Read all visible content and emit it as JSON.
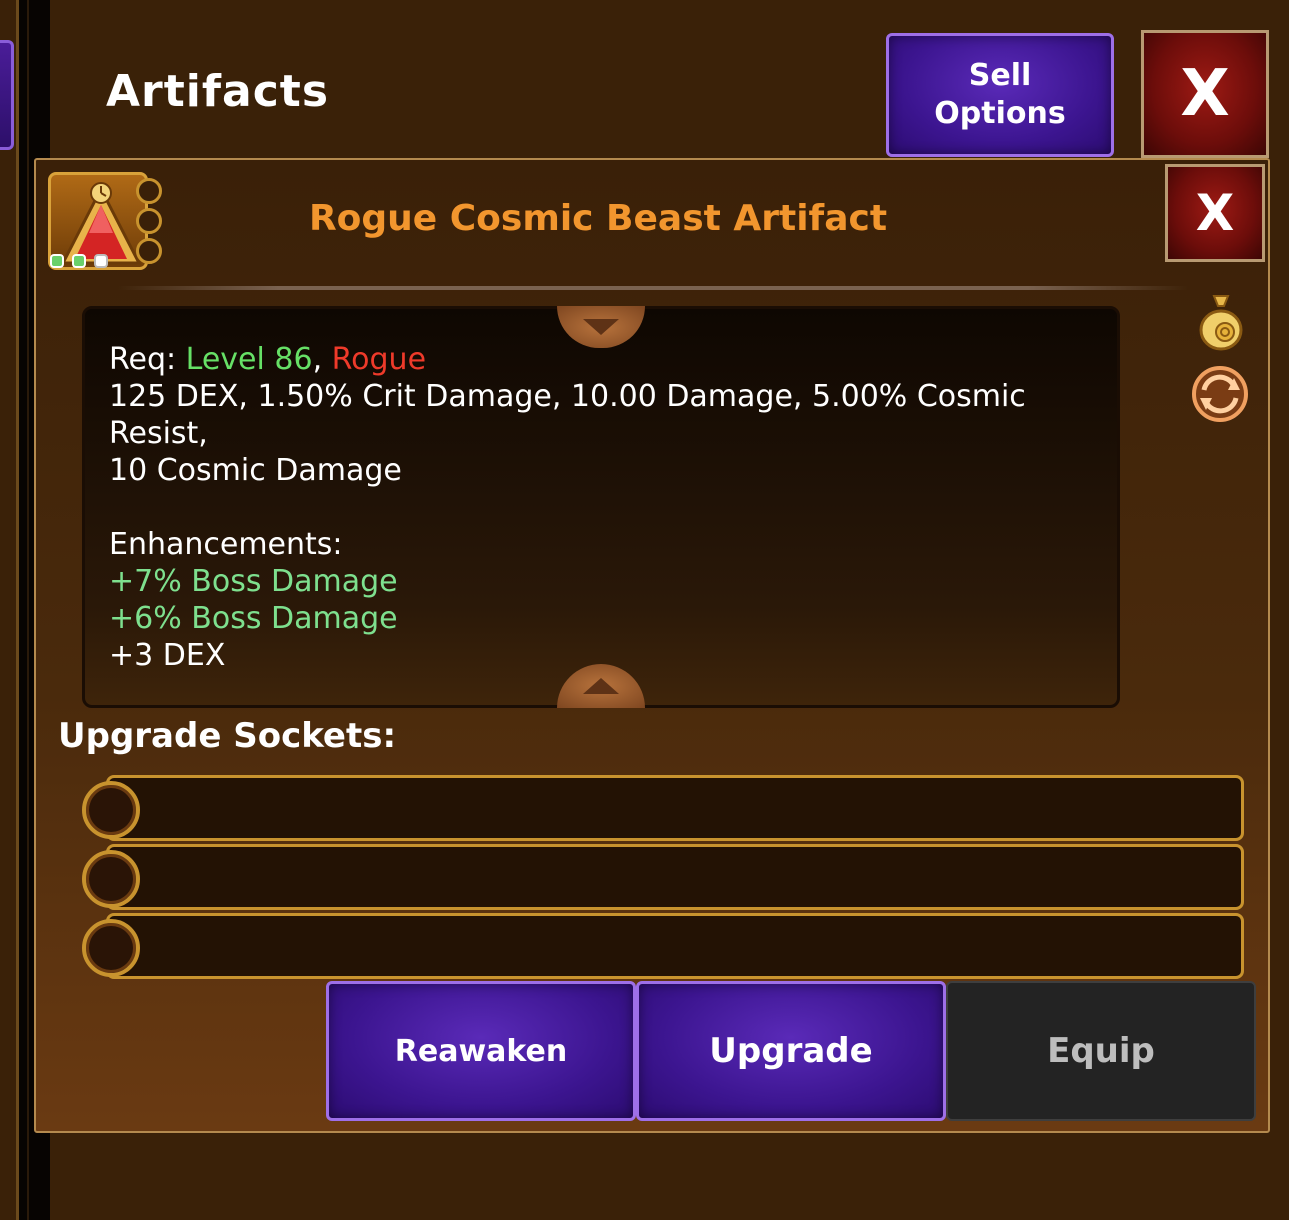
{
  "header": {
    "title": "Artifacts",
    "sell_options_line1": "Sell",
    "sell_options_line2": "Options",
    "close_label": "X"
  },
  "item": {
    "title": "Rogue Cosmic Beast Artifact",
    "close_label": "X",
    "icon": "artifact-triangle-icon",
    "req_label": "Req:",
    "req_level": "Level 86",
    "req_sep": ",",
    "req_class": "Rogue",
    "stats_line1": "125 DEX, 1.50% Crit Damage, 10.00 Damage, 5.00% Cosmic Resist,",
    "stats_line2": "10 Cosmic Damage",
    "enhancements_label": "Enhancements:",
    "enhancements": [
      "+7% Boss Damage",
      "+6% Boss Damage",
      "+3 DEX"
    ]
  },
  "sockets": {
    "label": "Upgrade Sockets:",
    "count": 3
  },
  "actions": {
    "reawaken": "Reawaken",
    "upgrade": "Upgrade",
    "equip": "Equip"
  },
  "icons": {
    "gold_bag": "gold-bag-icon",
    "refresh": "refresh-icon"
  },
  "colors": {
    "title_orange": "#f2962e",
    "level_green": "#66e066",
    "class_red": "#ee3a2a",
    "enhancement_green": "#7ee08e",
    "button_purple": "#3c1590",
    "close_red": "#6c0d0a"
  }
}
